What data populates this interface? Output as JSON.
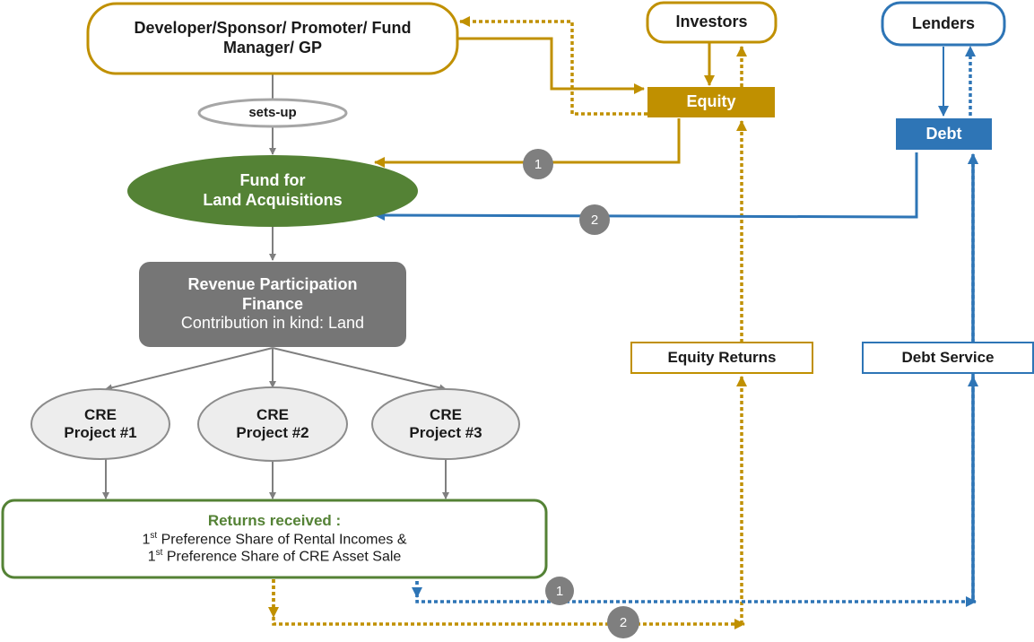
{
  "colors": {
    "equity": "#c09000",
    "debt": "#2e75b6",
    "fund": "#548235",
    "neutral": "#7f7f7f",
    "rpf_fill": "#767676",
    "project_fill": "#ededed",
    "text": "#1a1a1a"
  },
  "nodes": {
    "developer": {
      "line1": "Developer/Sponsor/ Promoter/ Fund",
      "line2": "Manager/ GP"
    },
    "sets_up": "sets-up",
    "fund": {
      "line1": "Fund for",
      "line2": "Land Acquisitions"
    },
    "rpf": {
      "line1": "Revenue Participation",
      "line2": "Finance",
      "line3": "Contribution in kind: Land"
    },
    "projects": [
      {
        "line1": "CRE",
        "line2": "Project #1"
      },
      {
        "line1": "CRE",
        "line2": "Project #2"
      },
      {
        "line1": "CRE",
        "line2": "Project #3"
      }
    ],
    "returns": {
      "title": "Returns received :",
      "line1_sup": "st",
      "line1_num": "1",
      "line1_text": " Preference Share of Rental Incomes &",
      "line2_num": "1",
      "line2_sup": "st",
      "line2_text": " Preference Share of CRE Asset Sale"
    },
    "investors": "Investors",
    "equity": "Equity",
    "lenders": "Lenders",
    "debt": "Debt",
    "equity_returns": "Equity Returns",
    "debt_service": "Debt Service"
  },
  "badges": {
    "equity_inflow": "1",
    "debt_inflow": "2",
    "debt_outflow": "1",
    "equity_outflow": "2"
  }
}
